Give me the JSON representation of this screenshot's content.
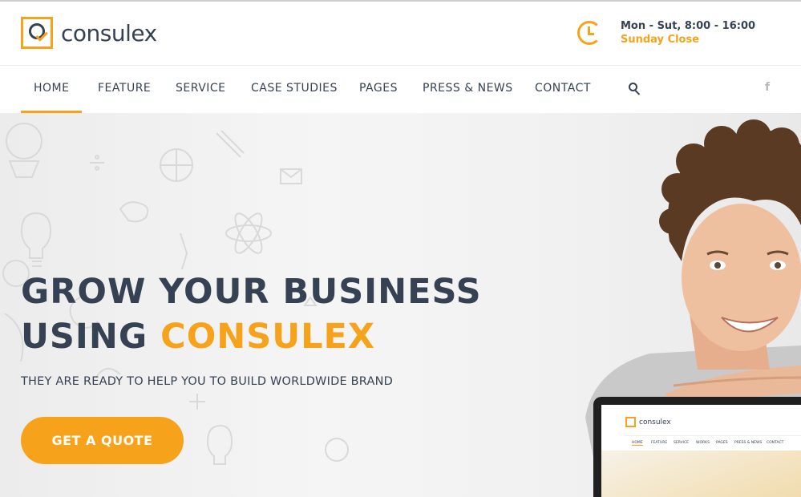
{
  "header": {
    "logo_text": "consulex",
    "hours_line1": "Mon - Sut, 8:00 - 16:00",
    "hours_line2": "Sunday Close"
  },
  "nav": {
    "items": [
      {
        "label": "HOME",
        "active": true
      },
      {
        "label": "FEATURE"
      },
      {
        "label": "SERVICE"
      },
      {
        "label": "CASE STUDIES"
      },
      {
        "label": "PAGES"
      },
      {
        "label": "PRESS & NEWS"
      },
      {
        "label": "CONTACT"
      }
    ],
    "social_label": "f"
  },
  "hero": {
    "headline_line1": "GROW YOUR BUSINESS",
    "headline_prefix": "USING",
    "headline_accent": "CONSULEX",
    "subline": "THEY ARE READY TO HELP YOU TO BUILD WORLDWIDE BRAND",
    "cta_label": "GET A QUOTE"
  },
  "laptop_preview": {
    "logo_text": "consulex",
    "nav": [
      "HOME",
      "FEATURE",
      "SERVICE",
      "WORKS",
      "PAGES",
      "PRESS & NEWS",
      "CONTACT"
    ]
  },
  "colors": {
    "accent": "#f7a21b",
    "text_dark": "#364253"
  },
  "icons": [
    "clock-icon",
    "search-icon",
    "facebook-icon"
  ]
}
